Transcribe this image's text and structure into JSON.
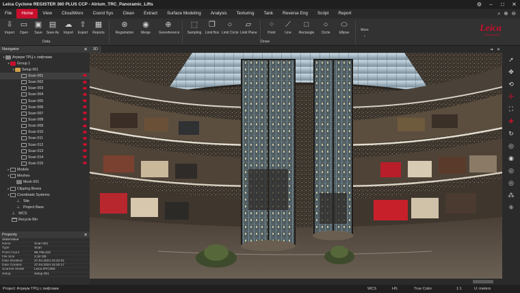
{
  "window": {
    "title": "Leica Cyclone REGISTER 360 PLUS CCP - Atrium_TRC_Panoramic_Lifts"
  },
  "menu": {
    "items": [
      "File",
      "Home",
      "View",
      "CloudWorx",
      "Coord Sys",
      "Clean",
      "Extract",
      "Surface Modeling",
      "Analysis",
      "Texturing",
      "Tank",
      "Reverse Eng",
      "Script",
      "Report"
    ],
    "active": "Home"
  },
  "ribbon": {
    "data_group": {
      "label": "Data",
      "buttons": [
        "Import",
        "Open",
        "Save",
        "Save As",
        "Import",
        "Export",
        "Reports"
      ]
    },
    "mid_buttons": [
      "Registration",
      "Merge",
      "Georeference"
    ],
    "draw_group": {
      "label": "Draw",
      "buttons": [
        "Sampling",
        "Limit Box",
        "Limit Circle",
        "Limit Plane",
        "Point",
        "Line",
        "Rectangle",
        "Circle",
        "Ellipse"
      ]
    },
    "more_label": "More",
    "brand": {
      "name": "Leica",
      "tagline": "Geosystems",
      "color": "#c8102e"
    }
  },
  "navigator": {
    "title": "Navigator",
    "project": "Атриум ТРЦ с лифтами",
    "group": "Group 1",
    "setup": "Setup 001",
    "scans": [
      "Scan 001",
      "Scan 002",
      "Scan 003",
      "Scan 004",
      "Scan 005",
      "Scan 006",
      "Scan 007",
      "Scan 008",
      "Scan 009",
      "Scan 010",
      "Scan 011",
      "Scan 012",
      "Scan 013",
      "Scan 014",
      "Scan 015"
    ],
    "selected_scan": "Scan 001",
    "models": "Models",
    "meshes": "Meshes",
    "mesh": "Mesh 001",
    "clipping": "Clipping Boxes",
    "coord": "Coordinate Systems",
    "ucs_site": "Site",
    "ucs_base": "Project Base",
    "wcs": "WCS",
    "recycle": "Recycle Bin"
  },
  "property": {
    "title": "Property",
    "header": {
      "k": "State/Value",
      "v": ""
    },
    "rows": [
      {
        "k": "Name",
        "v": "Scan 001"
      },
      {
        "k": "Type",
        "v": "Scan"
      },
      {
        "k": "Point Count",
        "v": "98,765,432"
      },
      {
        "k": "File Size",
        "v": "2.34 GB"
      },
      {
        "k": "Date Modified",
        "v": "27.04.2024 15:22:31"
      },
      {
        "k": "Date Created",
        "v": "27.04.2024 15:20:17"
      },
      {
        "k": "Scanner Model",
        "v": "Leica RTC360"
      },
      {
        "k": "Setup",
        "v": "Setup 001"
      }
    ]
  },
  "viewport": {
    "tab": "3D"
  },
  "status": {
    "project": "Project: Атриум ТРЦ с лифтами",
    "wcs": "WCS",
    "hs": "HS",
    "color": "True Color",
    "scale": "1:1",
    "units": "U: meters"
  }
}
